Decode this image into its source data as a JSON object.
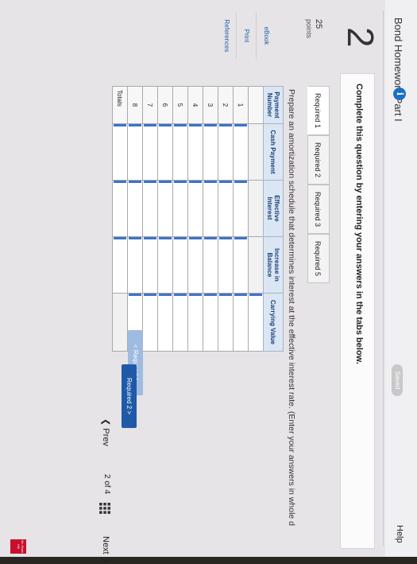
{
  "header": {
    "title": "Bond Homework Part I",
    "info_icon": "i",
    "saved": "Saved",
    "help": "Help"
  },
  "question": {
    "number": "2",
    "instruction": "Complete this question by entering your answers in the tabs below.",
    "points": "25",
    "points_label": "points"
  },
  "side_menu": [
    "eBook",
    "Print",
    "References"
  ],
  "tabs": [
    "Required 1",
    "Required 2",
    "Required 3",
    "Required 5"
  ],
  "active_tab": "Required 1",
  "prompt": "Prepare an amortization schedule that determines interest at the effective interest rate. (Enter your answers in whole d",
  "table": {
    "headers": [
      "Payment Number",
      "Cash Payment",
      "Effective Interest",
      "Increase in Balance",
      "Carrying Value"
    ],
    "rows": [
      "",
      "1",
      "2",
      "3",
      "4",
      "5",
      "6",
      "7",
      "8"
    ],
    "totals_label": "Totals"
  },
  "buttons": {
    "prev_required": "< Required 1",
    "next_required": "Required 2 >"
  },
  "pager": {
    "prev": "Prev",
    "count": "2 of 4",
    "next": "Next"
  },
  "logo": "Mc Graw Hill",
  "colors": {
    "accent": "#1f5aa8",
    "header_fill": "#dbe6f5",
    "logo": "#c8102e"
  }
}
